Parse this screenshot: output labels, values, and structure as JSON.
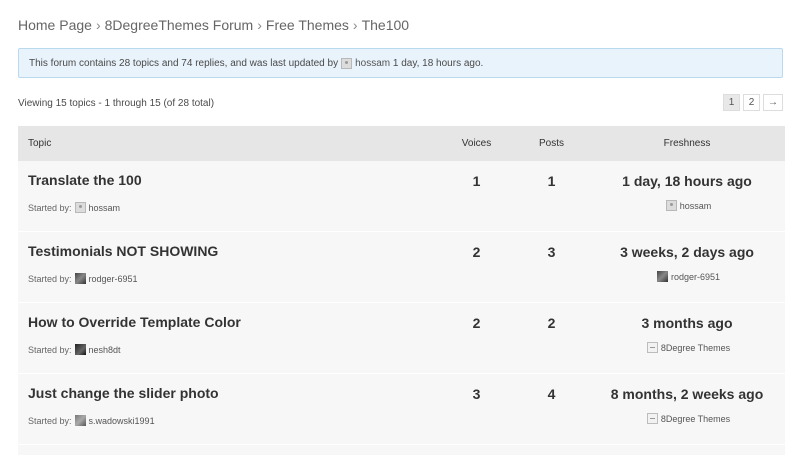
{
  "breadcrumb": [
    "Home Page",
    "8DegreeThemes Forum",
    "Free Themes",
    "The100"
  ],
  "breadcrumb_sep": "›",
  "notice": {
    "prefix": "This forum contains 28 topics and 74 replies, and was last updated by",
    "user": "hossam",
    "suffix": "1 day, 18 hours ago."
  },
  "viewing": "Viewing 15 topics - 1 through 15 (of 28 total)",
  "pagination": {
    "pages": [
      "1",
      "2"
    ],
    "current": "1",
    "next": "→"
  },
  "table": {
    "headers": {
      "topic": "Topic",
      "voices": "Voices",
      "posts": "Posts",
      "freshness": "Freshness"
    },
    "started_label": "Started by:",
    "rows": [
      {
        "title": "Translate the 100",
        "author": "hossam",
        "voices": "1",
        "posts": "1",
        "freshness": "1 day, 18 hours ago",
        "last_by": "hossam"
      },
      {
        "title": "Testimonials NOT SHOWING",
        "author": "rodger-6951",
        "voices": "2",
        "posts": "3",
        "freshness": "3 weeks, 2 days ago",
        "last_by": "rodger-6951"
      },
      {
        "title": "How to Override Template Color",
        "author": "nesh8dt",
        "voices": "2",
        "posts": "2",
        "freshness": "3 months ago",
        "last_by": "8Degree Themes"
      },
      {
        "title": "Just change the slider photo",
        "author": "s.wadowski1991",
        "voices": "3",
        "posts": "4",
        "freshness": "8 months, 2 weeks ago",
        "last_by": "8Degree Themes"
      }
    ]
  }
}
